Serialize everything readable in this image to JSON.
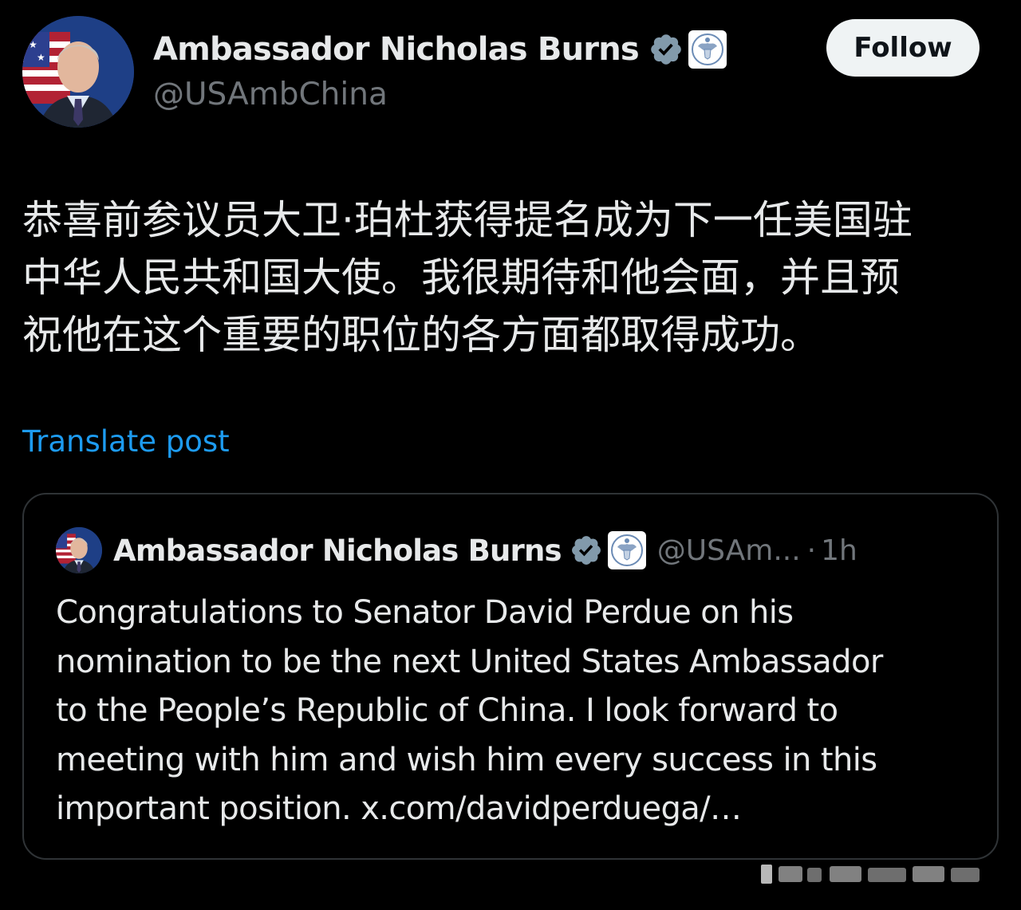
{
  "author": {
    "display_name": "Ambassador Nicholas Burns",
    "handle": "@USAmbChina",
    "avatar": "avatar-nicholas-burns",
    "verified_icon": "verified-badge-icon",
    "affiliation_icon": "us-state-department-seal-icon"
  },
  "follow_button": {
    "label": "Follow"
  },
  "post": {
    "text_lines": [
      "恭喜前参议员大卫·珀杜获得提名成为下一任美国驻",
      "中华人民共和国大使。我很期待和他会面，并且预",
      "祝他在这个重要的职位的各方面都取得成功。"
    ],
    "translate_label": "Translate post"
  },
  "quoted_post": {
    "display_name": "Ambassador Nicholas Burns",
    "handle": "@USAm...",
    "separator": "·",
    "time": "1h",
    "text_lines": [
      "Congratulations to Senator David Perdue on his",
      "nomination to be the next United States Ambassador",
      "to the People’s Republic of China.  I look forward to",
      "meeting with him and wish him every success in this",
      "important position. x.com/davidperduega/…"
    ]
  },
  "colors": {
    "background": "#000000",
    "primary_text": "#e7e9ea",
    "secondary_text": "#71767b",
    "link": "#1d9bf0",
    "verified_badge": "#829aab",
    "card_border": "#2f3336",
    "follow_bg": "#eff3f4"
  }
}
